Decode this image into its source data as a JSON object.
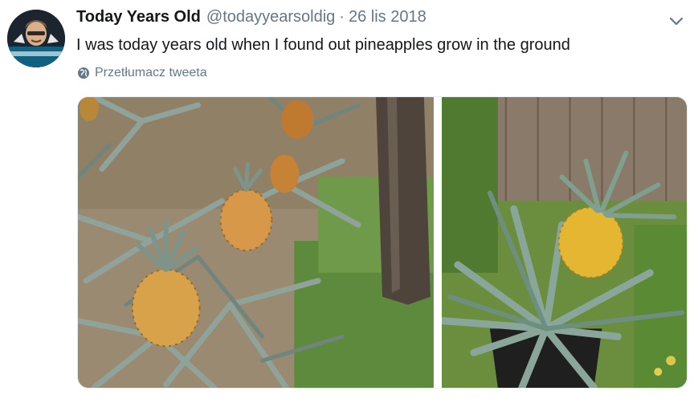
{
  "tweet": {
    "display_name": "Today Years Old",
    "handle": "@todayyearsoldig",
    "separator": "·",
    "date": "26 lis 2018",
    "text": "I was today years old when I found out pineapples grow in the ground",
    "translate_label": "Przetłumacz tweeta"
  },
  "icons": {
    "menu": "chevron-down-icon",
    "translate": "globe-icon"
  },
  "colors": {
    "text_primary": "#14171a",
    "text_secondary": "#657786",
    "border": "#e6ecf0"
  }
}
